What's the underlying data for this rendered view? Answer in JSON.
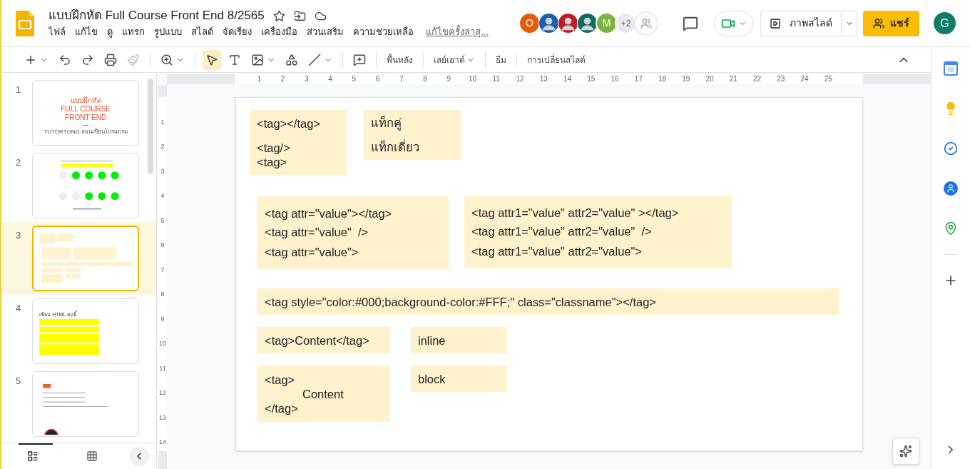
{
  "header": {
    "title": "แบบฝึกหัด Full Course Front End 8/2565",
    "menu": [
      "ไฟล์",
      "แก้ไข",
      "ดู",
      "แทรก",
      "รูปแบบ",
      "สไลด์",
      "จัดเรียง",
      "เครื่องมือ",
      "ส่วนเสริม",
      "ความช่วยเหลือ"
    ],
    "last_edit_link": "แก้ไขครั้งล่าสุ...",
    "collaborators": [
      {
        "kind": "letter",
        "text": "O",
        "color": "#e8590c"
      },
      {
        "kind": "picture",
        "color": "#1a5fb4"
      },
      {
        "kind": "picture",
        "color": "#c01c28"
      },
      {
        "kind": "picture",
        "color": "#0f6e5b"
      },
      {
        "kind": "letter",
        "text": "M",
        "color": "#7cb342"
      },
      {
        "kind": "count",
        "text": "+2",
        "color": "#e8eaed"
      }
    ],
    "slideshow_button": "ภาพสไลด์",
    "share_button": "แชร์",
    "account_avatar": "G"
  },
  "toolbar": {
    "tools": [
      {
        "kind": "new",
        "selected": false
      },
      {
        "kind": "undo",
        "selected": false
      },
      {
        "kind": "redo",
        "selected": false
      },
      {
        "kind": "print",
        "selected": false
      },
      {
        "kind": "paint",
        "selected": false
      },
      {
        "kind": "zoom",
        "selected": false
      },
      {
        "kind": "select",
        "selected": true
      },
      {
        "kind": "textbox",
        "selected": false
      },
      {
        "kind": "image",
        "selected": false
      },
      {
        "kind": "shape",
        "selected": false
      },
      {
        "kind": "line",
        "selected": false
      },
      {
        "kind": "comment",
        "selected": false
      }
    ],
    "text_buttons": [
      {
        "label": "พื้นหลัง",
        "dropdown": false
      },
      {
        "label": "เลย์เอาต์",
        "dropdown": true
      },
      {
        "label": "ธีม",
        "dropdown": false
      },
      {
        "label": "การเปลี่ยนสไลด์",
        "dropdown": false
      }
    ]
  },
  "slides": [
    {
      "number": "1",
      "selected": false,
      "kind": "title",
      "title_lines": [
        "แบบฝึกหัด",
        "FULL COURSE",
        "FRONT END"
      ],
      "subtitle": "TUTORTONG สอนเขียนโปรแกรม"
    },
    {
      "number": "2",
      "selected": false,
      "kind": "dots"
    },
    {
      "number": "3",
      "selected": true,
      "kind": "boxes"
    },
    {
      "number": "4",
      "selected": false,
      "kind": "yellow-list",
      "heading": "เขียน HTML ต่อนี้"
    },
    {
      "number": "5",
      "selected": false,
      "kind": "code"
    }
  ],
  "rulers": {
    "horizontal": [
      "1",
      "2",
      "3",
      "4",
      "5",
      "6",
      "7",
      "8",
      "9",
      "10",
      "11",
      "12",
      "13",
      "14",
      "15",
      "16",
      "17",
      "18",
      "19",
      "20",
      "21",
      "22",
      "23",
      "24",
      "25"
    ],
    "vertical": [
      "1",
      "2",
      "3",
      "4",
      "5",
      "6",
      "7",
      "8",
      "9",
      "10",
      "11",
      "12",
      "13",
      "14"
    ]
  },
  "slide": {
    "boxes": [
      {
        "lines": [
          {
            "text": "<tag></tag>",
            "indented": false
          },
          {
            "text": "<tag/>",
            "indented": false
          },
          {
            "text": "<tag>",
            "indented": false
          }
        ]
      },
      {
        "lines": [
          {
            "text": "แท็กคู่",
            "indented": false
          },
          {
            "text": "แท็กเดี่ยว",
            "indented": false
          }
        ]
      },
      {
        "lines": [
          {
            "text": "<tag attr=\"value\"></tag>",
            "indented": false
          },
          {
            "text": "<tag attr=\"value\"  />",
            "indented": false
          },
          {
            "text": "<tag attr=\"value\">",
            "indented": false
          }
        ]
      },
      {
        "lines": [
          {
            "text": "<tag attr1=\"value\" attr2=\"value\" ></tag>",
            "indented": false
          },
          {
            "text": "<tag attr1=\"value\" attr2=\"value\"  />",
            "indented": false
          },
          {
            "text": "<tag attr1=\"value\" attr2=\"value\">",
            "indented": false
          }
        ]
      },
      {
        "lines": [
          {
            "text": "<tag style=\"color:#000;background-color:#FFF;\" class=\"classname\"></tag>",
            "indented": false
          }
        ]
      },
      {
        "lines": [
          {
            "text": "<tag>Content</tag>",
            "indented": false
          }
        ]
      },
      {
        "lines": [
          {
            "text": "inline",
            "indented": false
          }
        ]
      },
      {
        "lines": [
          {
            "text": "<tag>",
            "indented": false
          },
          {
            "text": "Content",
            "indented": true
          },
          {
            "text": "</tag>",
            "indented": false
          }
        ]
      },
      {
        "lines": [
          {
            "text": "block",
            "indented": false
          }
        ]
      }
    ]
  }
}
